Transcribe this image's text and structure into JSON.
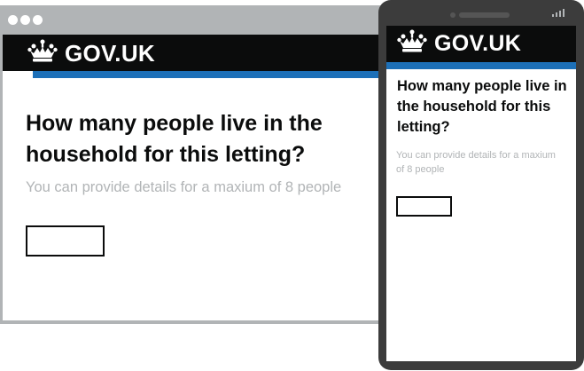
{
  "desktop": {
    "logo_text": "GOV.UK",
    "question": "How many people live in the household for this letting?",
    "hint": "You can provide details for a maxium of 8 people",
    "input_value": ""
  },
  "mobile": {
    "logo_text": "GOV.UK",
    "question": "How many people live in the household for this letting?",
    "hint": "You can provide details for a maxium of 8 people",
    "input_value": ""
  },
  "colors": {
    "header_black": "#0b0c0c",
    "header_blue": "#1d70b8",
    "hint_grey": "#b1b4b6",
    "frame_grey": "#b1b4b6",
    "phone_frame": "#3c3c3c"
  },
  "icons": {
    "crown": "crown-icon",
    "window_dots": "browser-dots-icon",
    "signal": "signal-icon"
  }
}
